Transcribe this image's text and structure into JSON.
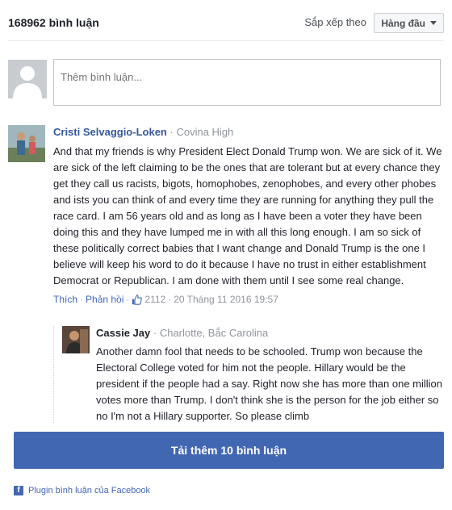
{
  "header": {
    "count": "168962 bình luận",
    "sort_label": "Sắp xếp theo",
    "sort_value": "Hàng đầu"
  },
  "composer": {
    "placeholder": "Thêm bình luận..."
  },
  "comment": {
    "author": "Cristi Selvaggio-Loken",
    "separator": "·",
    "affiliation": "Covina High",
    "text": "And that my friends is why President Elect Donald Trump won. We are sick of it. We are sick of the left claiming to be the ones that are tolerant but at every chance they get they call us racists, bigots, homophobes, zenophobes, and every other phobes and ists you can think of and every time they are running for anything they pull the race card. I am 56 years old and as long as I have been a voter they have been doing this and they have lumped me in with all this long enough. I am so sick of these politically correct babies that I want change and Donald Trump is the one I believe will keep his word to do it because I have no trust in either establishment Democrat or Republican. I am done with them until I see some real change.",
    "like_label": "Thích",
    "reply_label": "Phản hồi",
    "likes": "2112",
    "date": "20 Tháng 11 2016 19:57"
  },
  "reply": {
    "author": "Cassie Jay",
    "separator": "·",
    "affiliation": "Charlotte, Bắc Carolina",
    "text": "Another damn fool that needs to be schooled. Trump won because the Electoral College voted for him not the people. Hillary would be the president if the people had a say. Right now she has more than one million votes more than Trump. I don't think she is the person for the job either so no I'm not a Hillary supporter. So please climb"
  },
  "load_more_label": "Tải thêm 10 bình luận",
  "footer_label": "Plugin bình luận của Facebook",
  "colors": {
    "accent": "#4267b2",
    "author_link": "#365899",
    "muted": "#90949c"
  }
}
